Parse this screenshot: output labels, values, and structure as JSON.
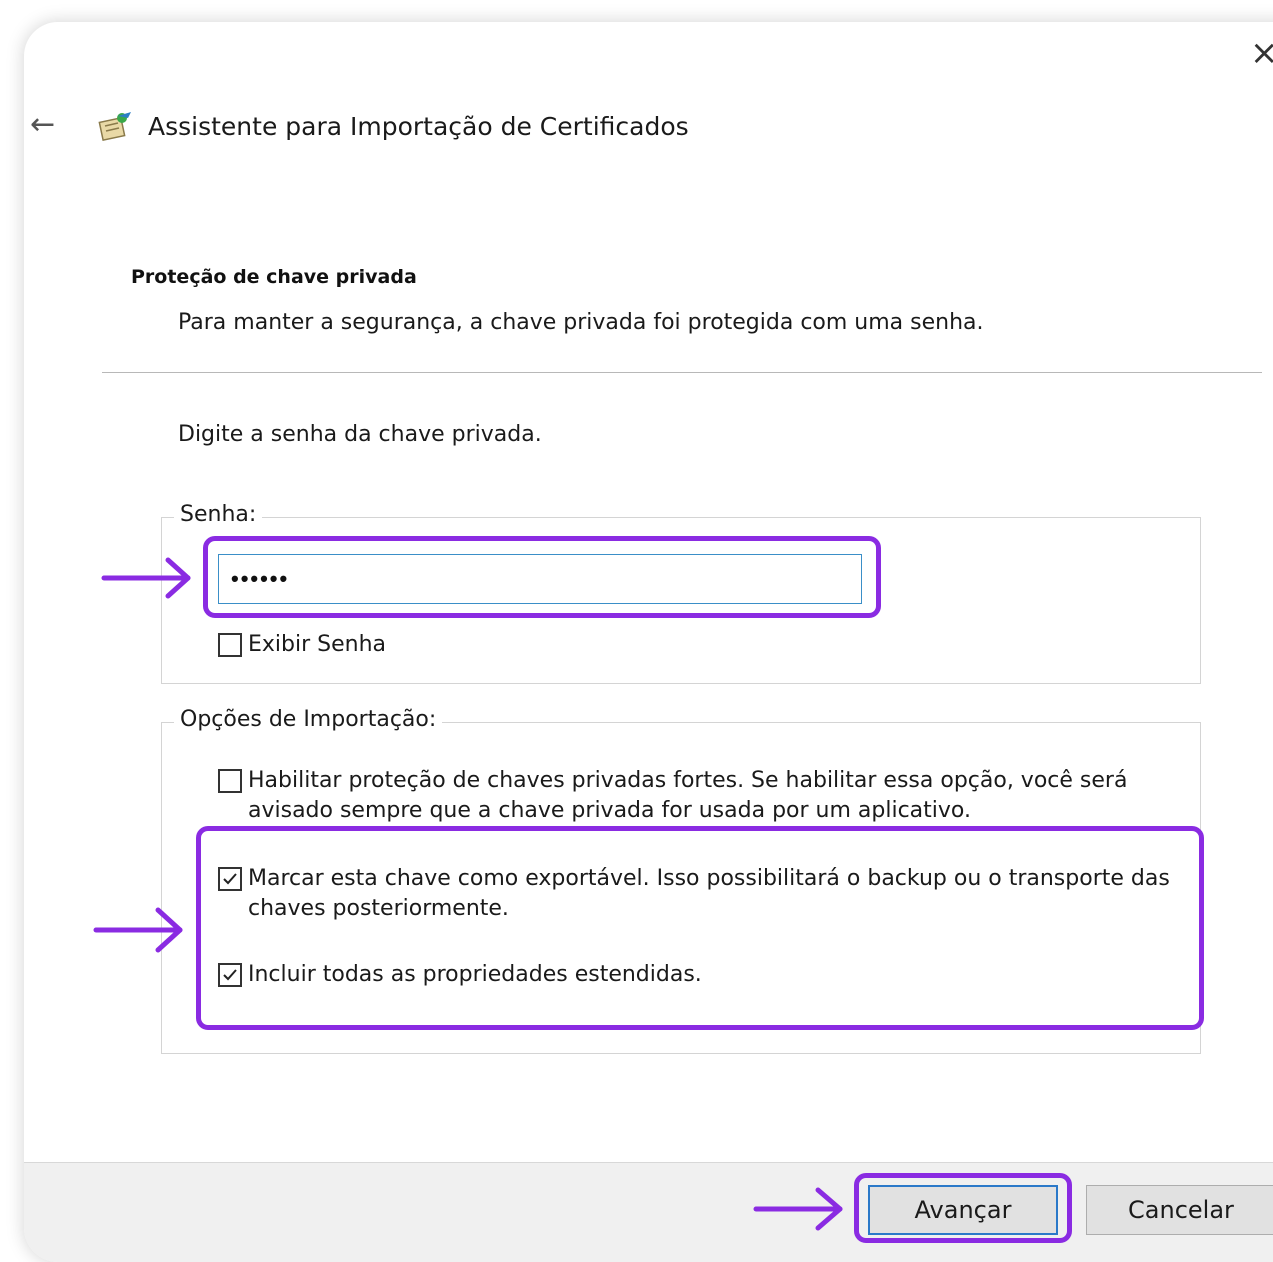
{
  "window": {
    "title": "Assistente para Importação de Certificados",
    "close_glyph": "×",
    "back_glyph": "←"
  },
  "section": {
    "title": "Proteção de chave privada",
    "description": "Para manter a segurança, a chave privada foi protegida com uma senha."
  },
  "prompt": "Digite a senha da chave privada.",
  "password_group": {
    "legend": "Senha:",
    "value": "••••••",
    "show_password": {
      "label": "Exibir Senha",
      "checked": false
    }
  },
  "import_options": {
    "legend": "Opções de Importação:",
    "options": [
      {
        "label": "Habilitar proteção de chaves privadas fortes. Se habilitar essa opção, você será avisado sempre que a chave privada for usada por um aplicativo.",
        "checked": false
      },
      {
        "label": "Marcar esta chave como exportável. Isso possibilitará o backup ou o transporte das chaves posteriormente.",
        "checked": true
      },
      {
        "label": "Incluir todas as propriedades estendidas.",
        "checked": true
      }
    ]
  },
  "footer": {
    "next_label": "Avançar",
    "cancel_label": "Cancelar"
  },
  "colors": {
    "annotation": "#8a2be2",
    "focus_border": "#2b79c9",
    "footer_bg": "#f0f0f0"
  }
}
